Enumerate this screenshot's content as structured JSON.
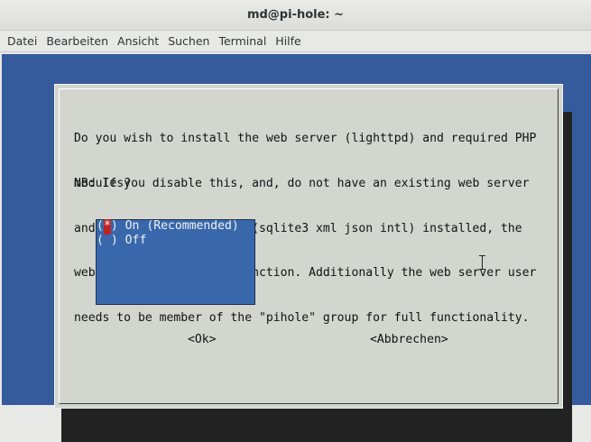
{
  "window": {
    "title": "md@pi-hole: ~"
  },
  "menu": [
    "Datei",
    "Bearbeiten",
    "Ansicht",
    "Suchen",
    "Terminal",
    "Hilfe"
  ],
  "dialog": {
    "question_lines": [
      "Do you wish to install the web server (lighttpd) and required PHP",
      "modules?"
    ],
    "note_lines": [
      "NB: If you disable this, and, do not have an existing web server",
      "and required PHP modules (sqlite3 xml json intl) installed, the",
      "web interface will not function. Additionally the web server user",
      "needs to be member of the \"pihole\" group for full functionality."
    ],
    "options": [
      {
        "mark": "*",
        "label": "On (Recommended)",
        "selected": true
      },
      {
        "mark": " ",
        "label": "Off",
        "selected": false
      }
    ],
    "ok_label": "<Ok>",
    "cancel_label": "<Abbrechen>"
  },
  "colors": {
    "terminal_bg": "#365b9d",
    "dialog_bg": "#d3d6cf",
    "listbox_bg": "#3868ab",
    "selected_mark": "#c32222"
  }
}
